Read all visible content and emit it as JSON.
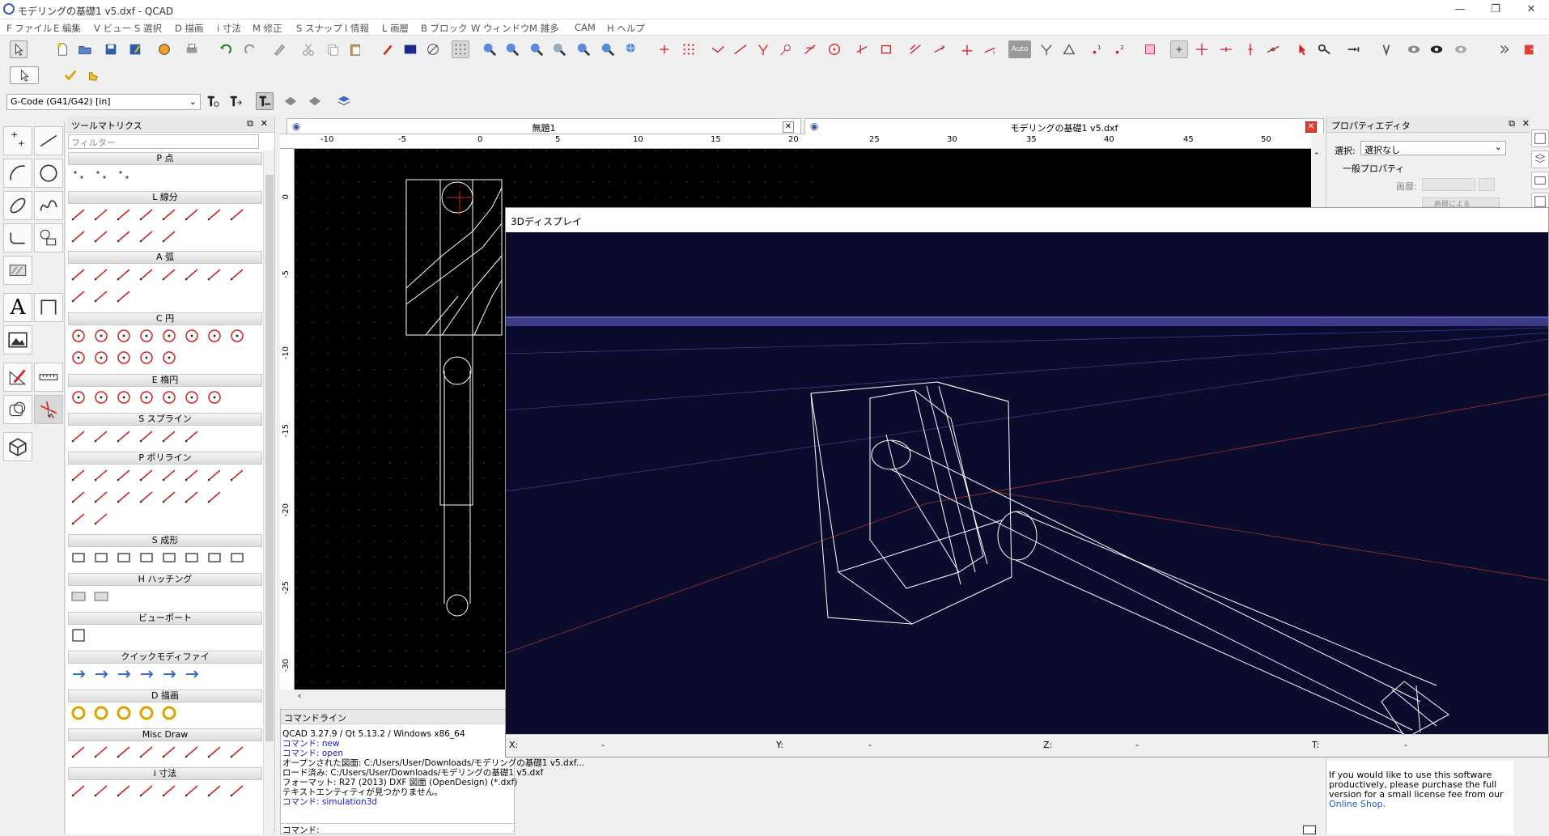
{
  "window": {
    "title": "モデリングの基礎1 v5.dxf - QCAD",
    "controls": [
      "—",
      "❐",
      "✕"
    ]
  },
  "menu": [
    "F ファイル",
    "E 編集",
    "V ビュー",
    "S 選択",
    "D 描画",
    "i 寸法",
    "M 修正",
    "S スナップ",
    "I 情報",
    "L 画層",
    "B ブロック",
    "W ウィンドウ",
    "M 雑多",
    "CAM",
    "H ヘルプ"
  ],
  "cam_toolbar": {
    "gcode_select": "G-Code (G41/G42) [in]"
  },
  "snap_auto_label": "Auto",
  "tool_matrix": {
    "title": "ツールマトリクス",
    "filter_placeholder": "フィルター",
    "sections": [
      "P 点",
      "L 線分",
      "A 弧",
      "C 円",
      "E 楕円",
      "S スプライン",
      "P ポリライン",
      "S 成形",
      "H ハッチング",
      "ビューポート",
      "クイックモディファイ",
      "D 描画",
      "Misc Draw",
      "i 寸法"
    ]
  },
  "tabs": [
    {
      "label": "無題1",
      "active": false
    },
    {
      "label": "モデリングの基礎1 v5.dxf",
      "active": true
    }
  ],
  "ruler_top": [
    "-10",
    "-5",
    "0",
    "5",
    "10",
    "15",
    "20",
    "25",
    "30",
    "35",
    "40",
    "45",
    "50"
  ],
  "ruler_left": [
    "0",
    "-5",
    "-10",
    "-15",
    "-20",
    "-25",
    "-30"
  ],
  "command_line": {
    "title": "コマンドライン",
    "lines": [
      {
        "text": "QCAD 3.27.9 / Qt 5.13.2 / Windows x86_64",
        "color": "#000000"
      },
      {
        "text": "コマンド: new",
        "color": "#1a1ac8"
      },
      {
        "text": "コマンド: open",
        "color": "#1a1ac8"
      },
      {
        "text": "オープンされた図面: C:/Users/User/Downloads/モデリングの基礎1 v5.dxf...",
        "color": "#000000"
      },
      {
        "text": "ロード済み: C:/Users/User/Downloads/モデリングの基礎1 v5.dxf",
        "color": "#000000"
      },
      {
        "text": "フォーマット: R27 (2013) DXF 図面 (OpenDesign) (*.dxf)",
        "color": "#000000"
      },
      {
        "text": "テキストエンティティが見つかりません。",
        "color": "#000000"
      },
      {
        "text": "コマンド: simulation3d",
        "color": "#1a1ac8"
      }
    ],
    "prompt": "コマンド:"
  },
  "property_editor": {
    "title": "プロパティエディタ",
    "select_label": "選択:",
    "select_value": "選択なし",
    "general_label": "一般プロパティ",
    "layer_label": "画層:",
    "color_value": "画層による"
  },
  "display3d": {
    "title": "3Dディスプレイ",
    "status": [
      {
        "label": "X:",
        "value": "-"
      },
      {
        "label": "Y:",
        "value": "-"
      },
      {
        "label": "Z:",
        "value": "-"
      },
      {
        "label": "T:",
        "value": "-"
      }
    ]
  },
  "shop_notice": {
    "text": "If you would like to use this software productively, please purchase the full version for a small license fee from our",
    "link": "Online Shop."
  },
  "colors": {
    "accent_red": "#d32020",
    "scene_bg": "#0b0b2e",
    "link": "#1a5fc0"
  }
}
